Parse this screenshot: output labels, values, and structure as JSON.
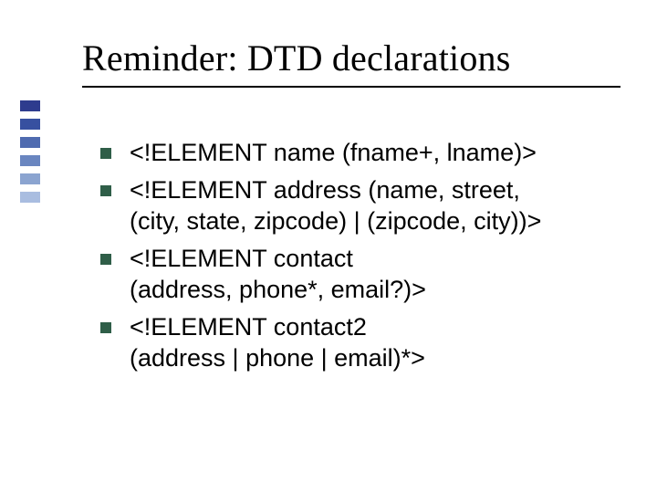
{
  "title": "Reminder: DTD declarations",
  "bullets": {
    "b0": {
      "l0": "<!ELEMENT name (fname+, lname)>"
    },
    "b1": {
      "l0": "<!ELEMENT address  (name, street,",
      "l1": "(city, state, zipcode) | (zipcode, city))>"
    },
    "b2": {
      "l0": "<!ELEMENT contact",
      "l1": "(address, phone*, email?)>"
    },
    "b3": {
      "l0": "<!ELEMENT contact2",
      "l1": "(address | phone | email)*>"
    }
  }
}
